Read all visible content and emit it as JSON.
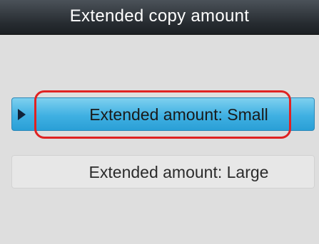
{
  "header": {
    "title": "Extended copy amount"
  },
  "menu": {
    "items": [
      {
        "label": "Extended amount: Small",
        "selected": true
      },
      {
        "label": "Extended amount: Large",
        "selected": false
      }
    ]
  },
  "colors": {
    "selected_item": "#3fb0e2",
    "highlight_ring": "#e02222",
    "title_bar": "#262b30"
  }
}
